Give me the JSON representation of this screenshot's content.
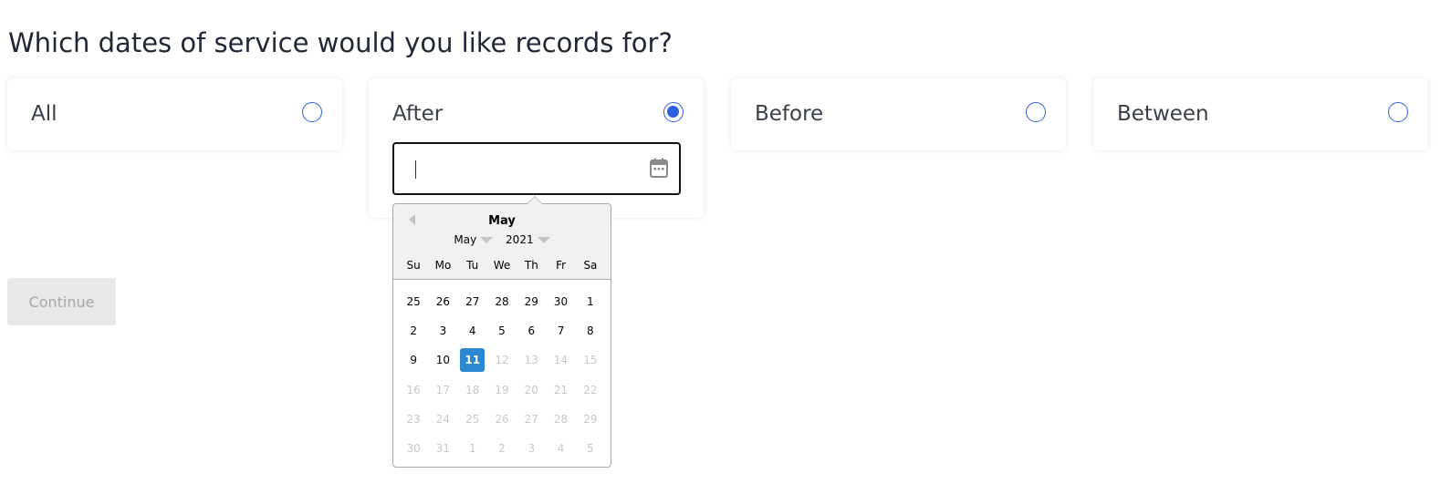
{
  "question": "Which dates of service would you like records for?",
  "options": [
    {
      "label": "All",
      "selected": false
    },
    {
      "label": "After",
      "selected": true
    },
    {
      "label": "Before",
      "selected": false
    },
    {
      "label": "Between",
      "selected": false
    }
  ],
  "date_input": {
    "value": "",
    "placeholder": ""
  },
  "datepicker": {
    "current_month": "May",
    "month_select": "May",
    "year_select": "2021",
    "weekdays": [
      "Su",
      "Mo",
      "Tu",
      "We",
      "Th",
      "Fr",
      "Sa"
    ],
    "weeks": [
      [
        {
          "d": "25",
          "disabled": false
        },
        {
          "d": "26",
          "disabled": false
        },
        {
          "d": "27",
          "disabled": false
        },
        {
          "d": "28",
          "disabled": false
        },
        {
          "d": "29",
          "disabled": false
        },
        {
          "d": "30",
          "disabled": false
        },
        {
          "d": "1",
          "disabled": false
        }
      ],
      [
        {
          "d": "2",
          "disabled": false
        },
        {
          "d": "3",
          "disabled": false
        },
        {
          "d": "4",
          "disabled": false
        },
        {
          "d": "5",
          "disabled": false
        },
        {
          "d": "6",
          "disabled": false
        },
        {
          "d": "7",
          "disabled": false
        },
        {
          "d": "8",
          "disabled": false
        }
      ],
      [
        {
          "d": "9",
          "disabled": false
        },
        {
          "d": "10",
          "disabled": false
        },
        {
          "d": "11",
          "disabled": false,
          "selected": true
        },
        {
          "d": "12",
          "disabled": true
        },
        {
          "d": "13",
          "disabled": true
        },
        {
          "d": "14",
          "disabled": true
        },
        {
          "d": "15",
          "disabled": true
        }
      ],
      [
        {
          "d": "16",
          "disabled": true
        },
        {
          "d": "17",
          "disabled": true
        },
        {
          "d": "18",
          "disabled": true
        },
        {
          "d": "19",
          "disabled": true
        },
        {
          "d": "20",
          "disabled": true
        },
        {
          "d": "21",
          "disabled": true
        },
        {
          "d": "22",
          "disabled": true
        }
      ],
      [
        {
          "d": "23",
          "disabled": true
        },
        {
          "d": "24",
          "disabled": true
        },
        {
          "d": "25",
          "disabled": true
        },
        {
          "d": "26",
          "disabled": true
        },
        {
          "d": "27",
          "disabled": true
        },
        {
          "d": "28",
          "disabled": true
        },
        {
          "d": "29",
          "disabled": true
        }
      ],
      [
        {
          "d": "30",
          "disabled": true
        },
        {
          "d": "31",
          "disabled": true
        },
        {
          "d": "1",
          "disabled": true
        },
        {
          "d": "2",
          "disabled": true
        },
        {
          "d": "3",
          "disabled": true
        },
        {
          "d": "4",
          "disabled": true
        },
        {
          "d": "5",
          "disabled": true
        }
      ]
    ]
  },
  "continue_label": "Continue",
  "colors": {
    "accent": "#2f5fe0",
    "selected_day": "#2a87d0",
    "text": "#232838",
    "disabled_button_bg": "#e8e8e8",
    "disabled_button_text": "#a8a8a8"
  },
  "icons": {
    "date_input": "calendar-icon",
    "prev_month": "triangle-left-icon"
  }
}
